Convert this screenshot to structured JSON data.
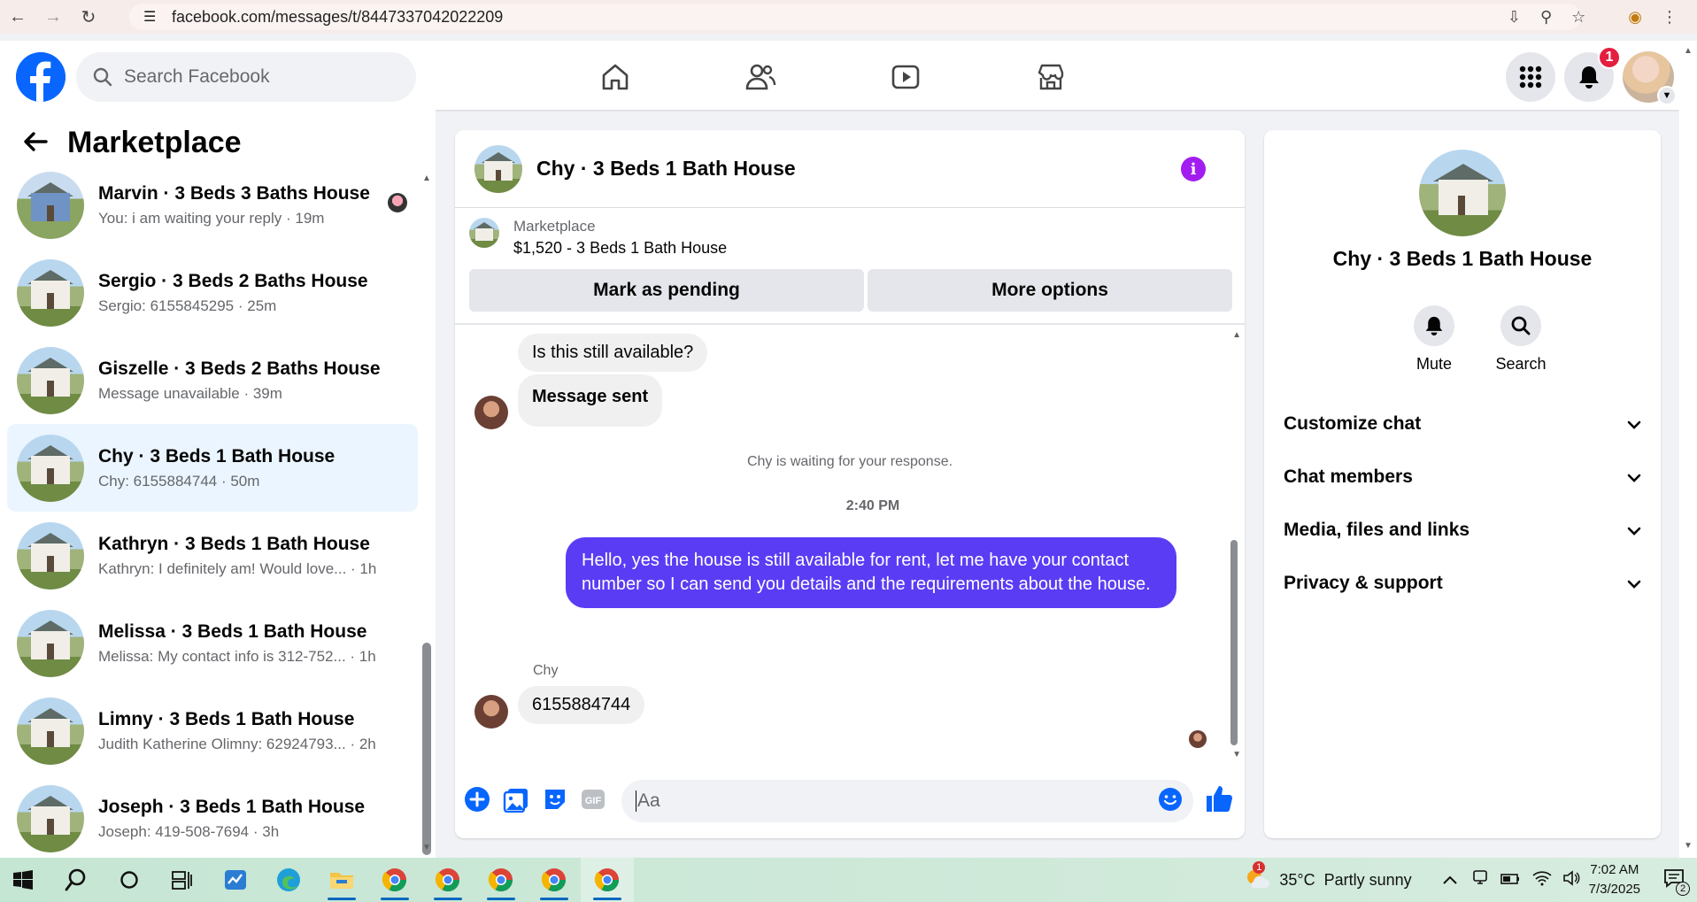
{
  "browser": {
    "url": "facebook.com/messages/t/8447337042022209"
  },
  "header": {
    "search_placeholder": "Search Facebook",
    "notifications_count": "1"
  },
  "sidebar": {
    "title": "Marketplace",
    "conversations": [
      {
        "name": "Marvin · 3 Beds 3 Baths House",
        "preview": "You: i am waiting your reply · 19m"
      },
      {
        "name": "Sergio · 3 Beds 2 Baths House",
        "preview": "Sergio: 6155845295 · 25m"
      },
      {
        "name": "Giszelle · 3 Beds 2 Baths House",
        "preview": "Message unavailable · 39m"
      },
      {
        "name": "Chy · 3 Beds 1 Bath House",
        "preview": "Chy: 6155884744 · 50m"
      },
      {
        "name": "Kathryn · 3 Beds 1 Bath House",
        "preview": "Kathryn: I definitely am! Would love... · 1h"
      },
      {
        "name": "Melissa · 3 Beds 1 Bath House",
        "preview": "Melissa: My contact info is 312-752... · 1h"
      },
      {
        "name": "Limny · 3 Beds 1 Bath House",
        "preview": "Judith Katherine Olimny: 62924793... · 2h"
      },
      {
        "name": "Joseph · 3 Beds 1 Bath House",
        "preview": "Joseph: 419-508-7694 · 3h"
      }
    ]
  },
  "chat": {
    "title": "Chy · 3 Beds 1 Bath House",
    "listing_label": "Marketplace",
    "listing_price": "$1,520 - 3 Beds 1 Bath House",
    "mark_pending": "Mark as pending",
    "more_options": "More options",
    "msg_question": "Is this still available?",
    "msg_sent": "Message sent",
    "waiting_text": "Chy is waiting for your response.",
    "time": "2:40 PM",
    "msg_reply": "Hello, yes the house is still available for rent, let me have your contact number so I can send you details and the requirements about the house.",
    "sender": "Chy",
    "msg_number": "6155884744",
    "composer_placeholder": "Aa"
  },
  "details": {
    "name": "Chy · 3 Beds 1 Bath House",
    "mute": "Mute",
    "search": "Search",
    "sections": [
      "Customize chat",
      "Chat members",
      "Media, files and links",
      "Privacy & support"
    ]
  },
  "taskbar": {
    "weather": "35°C  Partly sunny",
    "weather_badge": "1",
    "time": "7:02 AM",
    "date": "7/3/2025",
    "notif_count": "2"
  },
  "colors": {
    "accent": "#0866ff",
    "outgoing_bubble": "#5b3cf5",
    "info_purple": "#a21ef0",
    "badge_red": "#e41e3f"
  }
}
